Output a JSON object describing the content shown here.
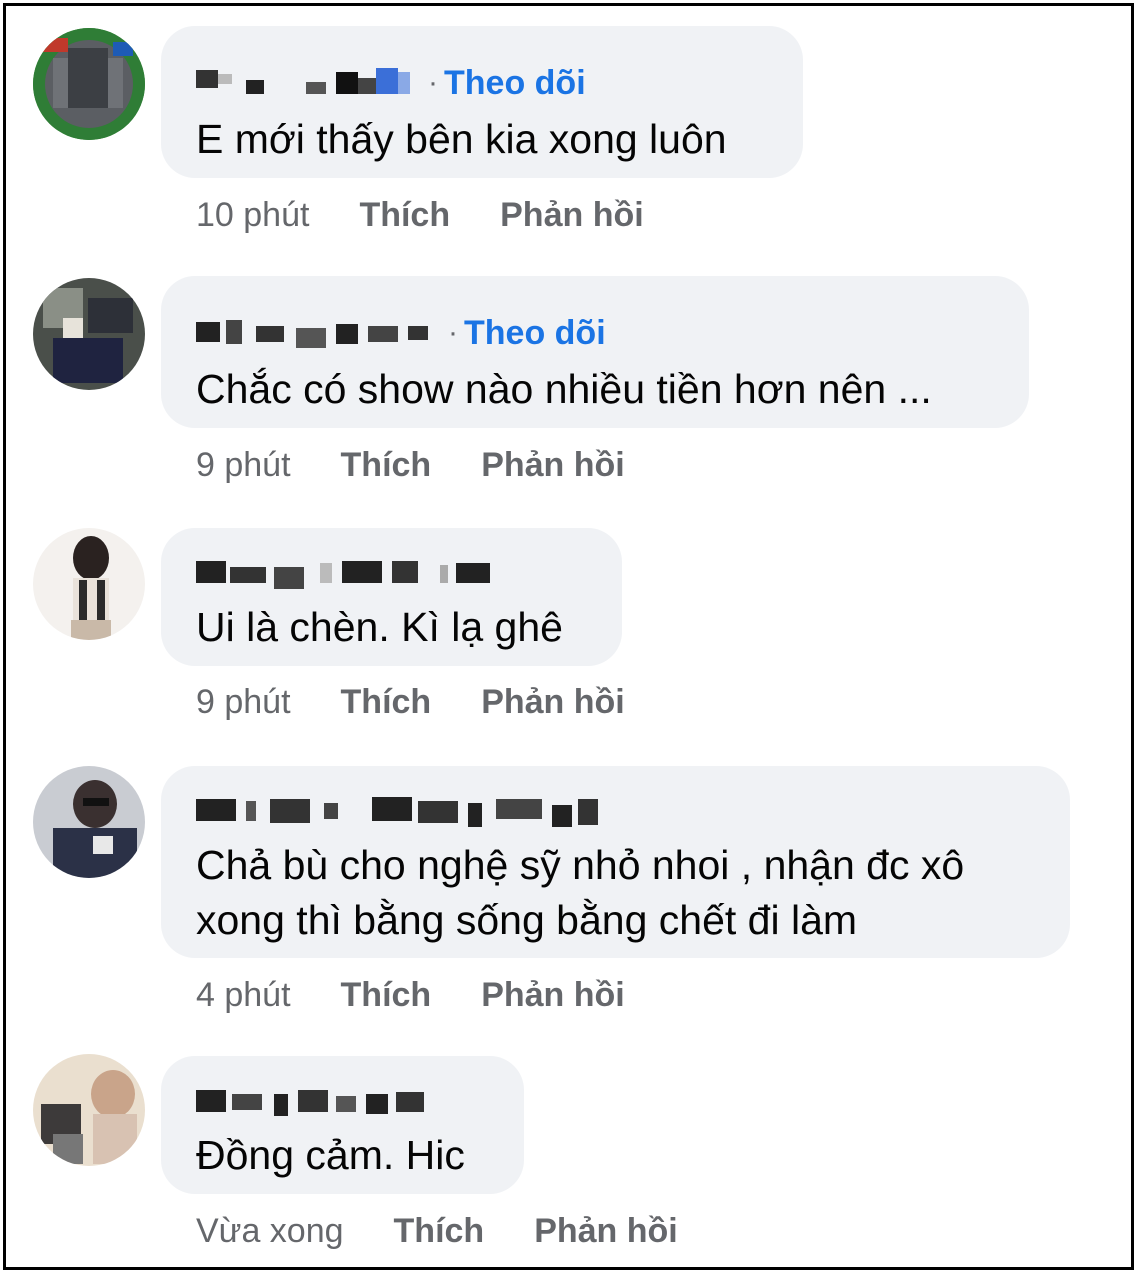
{
  "comments": [
    {
      "follow_label": "Theo dõi",
      "text": "E mới thấy bên kia xong luôn",
      "time": "10 phút",
      "like": "Thích",
      "reply": "Phản hồi"
    },
    {
      "follow_label": "Theo dõi",
      "text": "Chắc có show nào nhiều tiền hơn nên ...",
      "time": "9 phút",
      "like": "Thích",
      "reply": "Phản hồi"
    },
    {
      "text": "Ui là chèn. Kì lạ ghê",
      "time": "9 phút",
      "like": "Thích",
      "reply": "Phản hồi"
    },
    {
      "text": "Chả bù cho nghệ sỹ nhỏ nhoi , nhận đc xô xong thì bằng sống bằng chết đi làm",
      "time": "4 phút",
      "like": "Thích",
      "reply": "Phản hồi"
    },
    {
      "text": "Đồng cảm. Hic",
      "time": "Vừa xong",
      "like": "Thích",
      "reply": "Phản hồi"
    }
  ],
  "colors": {
    "follow": "#1b74e4",
    "bubble": "#f0f2f5",
    "meta": "#65676b",
    "text": "#050505"
  }
}
